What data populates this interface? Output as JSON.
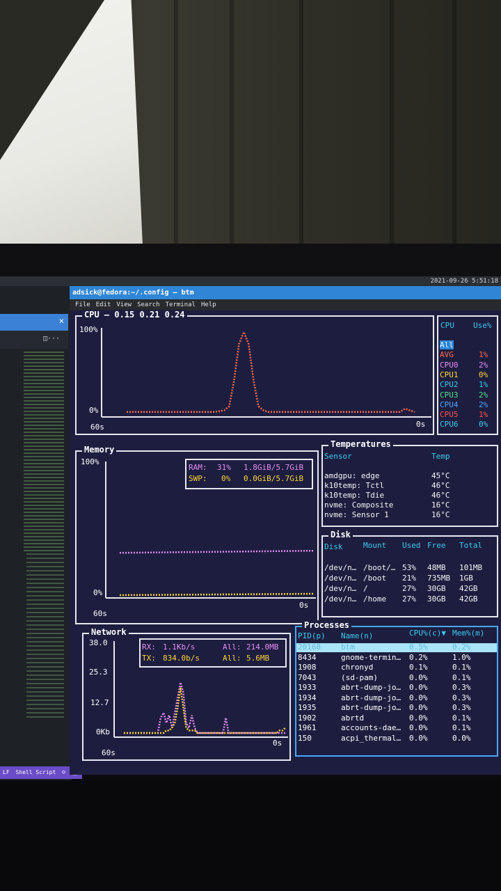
{
  "topbar": {
    "datetime": "2021-09-26  5:51:18"
  },
  "editor": {
    "close_glyph": "×",
    "statusbar": {
      "eol": "LF",
      "language": "Shell Script"
    }
  },
  "window": {
    "title": "adsick@fedora:~/.config — btm",
    "menu": [
      "File",
      "Edit",
      "View",
      "Search",
      "Terminal",
      "Help"
    ]
  },
  "cpu": {
    "title": "CPU — 0.15 0.21 0.24",
    "y_max_label": "100%",
    "y_min_label": "0%",
    "x_left_label": "60s",
    "x_right_label": "0s",
    "legend_header": {
      "name": "CPU",
      "use": "Use%"
    },
    "legend": [
      {
        "name": "All",
        "use": "",
        "color": "#4aa6ff",
        "selected": true
      },
      {
        "name": "AVG",
        "use": "1%",
        "color": "#ff6a4d"
      },
      {
        "name": "CPU0",
        "use": "2%",
        "color": "#e58cf5"
      },
      {
        "name": "CPU1",
        "use": "0%",
        "color": "#ffd23a"
      },
      {
        "name": "CPU2",
        "use": "1%",
        "color": "#3cc9f0"
      },
      {
        "name": "CPU3",
        "use": "2%",
        "color": "#53e08a"
      },
      {
        "name": "CPU4",
        "use": "2%",
        "color": "#4aa6ff"
      },
      {
        "name": "CPU5",
        "use": "1%",
        "color": "#ff5050"
      },
      {
        "name": "CPU6",
        "use": "0%",
        "color": "#3cc9f0"
      }
    ],
    "avg_series": [
      1,
      1,
      1,
      1,
      1,
      1,
      1,
      1,
      1,
      1,
      1,
      1,
      1,
      1,
      1,
      1,
      1,
      1,
      1,
      2,
      3,
      8,
      40,
      85,
      100,
      85,
      40,
      8,
      3,
      1,
      1,
      1,
      1,
      1,
      1,
      1,
      1,
      1,
      1,
      1,
      1,
      1,
      1,
      1,
      1,
      1,
      1,
      1,
      1,
      1,
      1,
      1,
      1,
      1,
      1,
      1,
      1,
      5,
      3,
      1
    ]
  },
  "memory": {
    "title": "Memory",
    "y_max_label": "100%",
    "y_min_label": "0%",
    "x_left_label": "60s",
    "x_right_label": "0s",
    "ram": {
      "label": "RAM:",
      "percent": "31%",
      "detail": "1.8GiB/5.7GiB",
      "value": 31,
      "color": "#e58cf5"
    },
    "swp": {
      "label": "SWP:",
      "percent": "0%",
      "detail": "0.0GiB/5.7GiB",
      "value": 0,
      "color": "#ffd23a"
    }
  },
  "temperatures": {
    "title": "Temperatures",
    "headers": {
      "sensor": "Sensor",
      "temp": "Temp"
    },
    "rows": [
      {
        "sensor": "amdgpu: edge",
        "temp": "45°C"
      },
      {
        "sensor": "k10temp: Tctl",
        "temp": "46°C"
      },
      {
        "sensor": "k10temp: Tdie",
        "temp": "46°C"
      },
      {
        "sensor": "nvme: Composite",
        "temp": "16°C"
      },
      {
        "sensor": "nvme: Sensor 1",
        "temp": "16°C"
      }
    ]
  },
  "disk": {
    "title": "Disk",
    "headers": {
      "disk": "Disk",
      "mount": "Mount",
      "used": "Used",
      "free": "Free",
      "total": "Total"
    },
    "rows": [
      {
        "disk": "/dev/n…",
        "mount": "/boot/…",
        "used": "53%",
        "free": "48MB",
        "total": "101MB"
      },
      {
        "disk": "/dev/n…",
        "mount": "/boot",
        "used": "21%",
        "free": "735MB",
        "total": "1GB"
      },
      {
        "disk": "/dev/n…",
        "mount": "/",
        "used": "27%",
        "free": "30GB",
        "total": "42GB"
      },
      {
        "disk": "/dev/n…",
        "mount": "/home",
        "used": "27%",
        "free": "30GB",
        "total": "42GB"
      }
    ]
  },
  "network": {
    "title": "Network",
    "y_labels": [
      "38.0",
      "25.3",
      "12.7",
      "0Kb"
    ],
    "x_left_label": "60s",
    "x_right_label": "0s",
    "rx": {
      "label": "RX:",
      "rate": "1.1Kb/s",
      "all_label": "All:",
      "all": "214.0MB",
      "color": "#e58cf5"
    },
    "tx": {
      "label": "TX:",
      "rate": "834.0b/s",
      "all_label": "All:",
      "all": "5.6MB",
      "color": "#ffd23a"
    },
    "rx_series": [
      0,
      0,
      0,
      0,
      0,
      0,
      0,
      0,
      0,
      0,
      0,
      0,
      0,
      6,
      8,
      4,
      7,
      2,
      8,
      14,
      20,
      16,
      4,
      2,
      7,
      2,
      0,
      0,
      0,
      0,
      0,
      0,
      0,
      0,
      0,
      0,
      6,
      0,
      0,
      0,
      0,
      0,
      0,
      0,
      0,
      0,
      0,
      0,
      0,
      0,
      0,
      0,
      0,
      0,
      0,
      0,
      0,
      0
    ],
    "tx_series": [
      0,
      0,
      0,
      0,
      0,
      0,
      0,
      0,
      0,
      0,
      0,
      0,
      0,
      0,
      0,
      1,
      1,
      2,
      4,
      10,
      18,
      10,
      2,
      1,
      1,
      1,
      0,
      0,
      0,
      0,
      0,
      0,
      0,
      0,
      0,
      0,
      0,
      0,
      0,
      0,
      0,
      0,
      0,
      0,
      0,
      0,
      0,
      0,
      0,
      0,
      0,
      0,
      0,
      0,
      0,
      1,
      1,
      2
    ]
  },
  "processes": {
    "title": "Processes",
    "headers": {
      "pid": "PID(p)",
      "name": "Name(n)",
      "cpu": "CPU%(c)▼",
      "mem": "Mem%(m)"
    },
    "rows": [
      {
        "pid": "20168",
        "name": "btm",
        "cpu": "0.5%",
        "mem": "0.2%",
        "selected": true
      },
      {
        "pid": "8434",
        "name": "gnome-termin…",
        "cpu": "0.2%",
        "mem": "1.0%"
      },
      {
        "pid": "1908",
        "name": "chronyd",
        "cpu": "0.1%",
        "mem": "0.1%"
      },
      {
        "pid": "7043",
        "name": "(sd-pam)",
        "cpu": "0.0%",
        "mem": "0.1%"
      },
      {
        "pid": "1933",
        "name": "abrt-dump-jo…",
        "cpu": "0.0%",
        "mem": "0.3%"
      },
      {
        "pid": "1934",
        "name": "abrt-dump-jo…",
        "cpu": "0.0%",
        "mem": "0.3%"
      },
      {
        "pid": "1935",
        "name": "abrt-dump-jo…",
        "cpu": "0.0%",
        "mem": "0.3%"
      },
      {
        "pid": "1902",
        "name": "abrtd",
        "cpu": "0.0%",
        "mem": "0.1%"
      },
      {
        "pid": "1961",
        "name": "accounts-dae…",
        "cpu": "0.0%",
        "mem": "0.1%"
      },
      {
        "pid": "150",
        "name": "acpi_thermal…",
        "cpu": "0.0%",
        "mem": "0.0%"
      }
    ]
  }
}
